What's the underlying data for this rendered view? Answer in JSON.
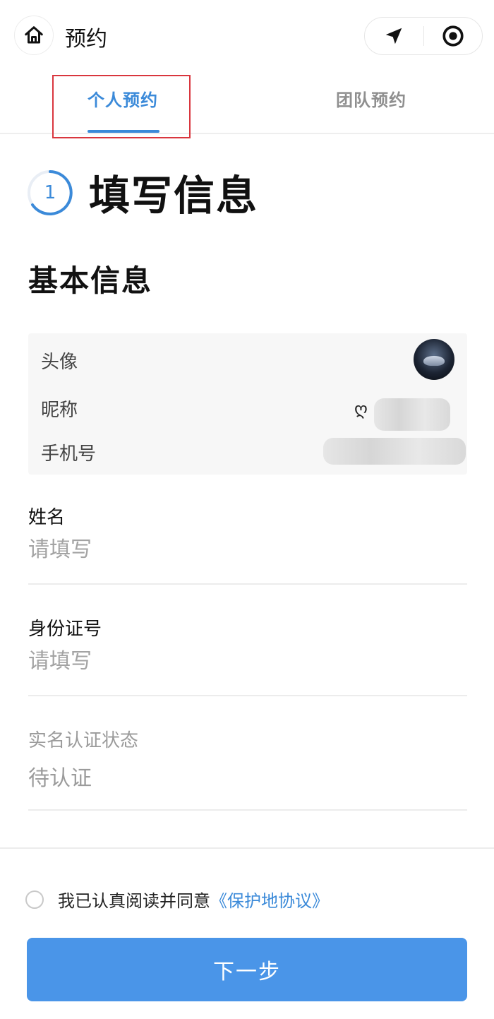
{
  "header": {
    "title": "预约",
    "home_icon": "home-icon",
    "capsule": [
      "navigation-arrow-icon",
      "record-target-icon"
    ]
  },
  "tabs": [
    {
      "label": "个人预约",
      "active": true
    },
    {
      "label": "团队预约",
      "active": false
    }
  ],
  "step": {
    "number": "1",
    "title": "填写信息"
  },
  "section_title": "基本信息",
  "basic_info": {
    "avatar_label": "头像",
    "nickname_label": "昵称",
    "nickname_prefix": "ღ",
    "phone_label": "手机号"
  },
  "form": {
    "name": {
      "label": "姓名",
      "placeholder": "请填写"
    },
    "id_number": {
      "label": "身份证号",
      "placeholder": "请填写"
    },
    "verification": {
      "label": "实名认证状态",
      "value": "待认证"
    }
  },
  "agreement": {
    "text": "我已认真阅读并同意",
    "link": "《保护地协议》",
    "checked": false
  },
  "next_button": "下一步",
  "colors": {
    "accent": "#3b8ad9",
    "button": "#4a95e8",
    "highlight": "#d9363e"
  }
}
